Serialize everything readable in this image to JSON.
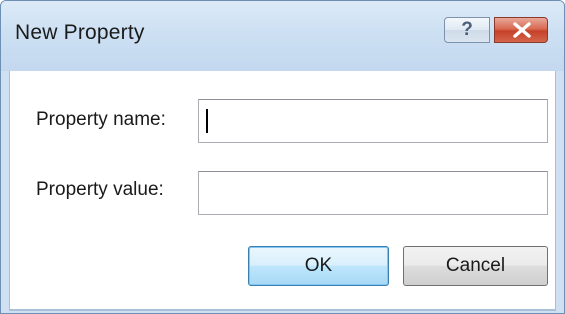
{
  "window": {
    "title": "New Property"
  },
  "titlebar": {
    "help_glyph": "?",
    "help_icon": "question-mark-icon",
    "close_icon": "close-x-icon"
  },
  "form": {
    "name_label": "Property name:",
    "name_value": "",
    "value_label": "Property value:",
    "value_value": ""
  },
  "buttons": {
    "ok_label": "OK",
    "cancel_label": "Cancel"
  },
  "colors": {
    "titlebar": "#cde0f3",
    "close_button": "#c6412a",
    "default_button_border": "#3c7fb1"
  }
}
